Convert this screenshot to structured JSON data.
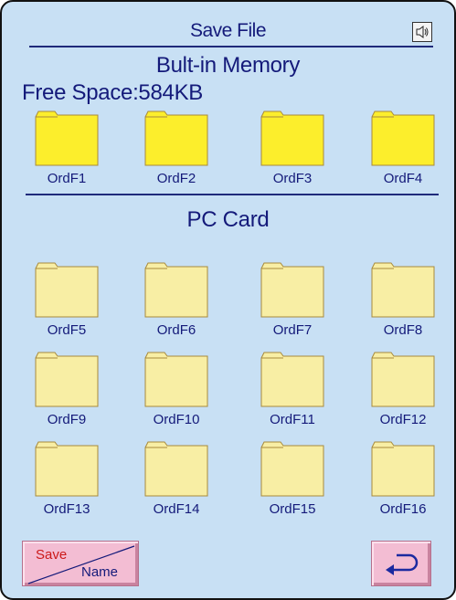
{
  "header": {
    "title": "Save File",
    "sound_icon": "speaker-icon"
  },
  "builtin": {
    "title": "Bult-in Memory",
    "free_space": "Free Space:584KB",
    "folders": [
      "OrdF1",
      "OrdF2",
      "OrdF3",
      "OrdF4"
    ],
    "folder_color": "#fcee2c"
  },
  "pccard": {
    "title": "PC Card",
    "folders": [
      "OrdF5",
      "OrdF6",
      "OrdF7",
      "OrdF8",
      "OrdF9",
      "OrdF10",
      "OrdF11",
      "OrdF12",
      "OrdF13",
      "OrdF14",
      "OrdF15",
      "OrdF16"
    ],
    "folder_color": "#f8eea4"
  },
  "buttons": {
    "save_top": "Save",
    "save_bottom": "Name",
    "back_icon": "return-arrow-icon"
  },
  "colors": {
    "background": "#c8e0f4",
    "text": "#141a7a",
    "button": "#f3bdd3"
  }
}
